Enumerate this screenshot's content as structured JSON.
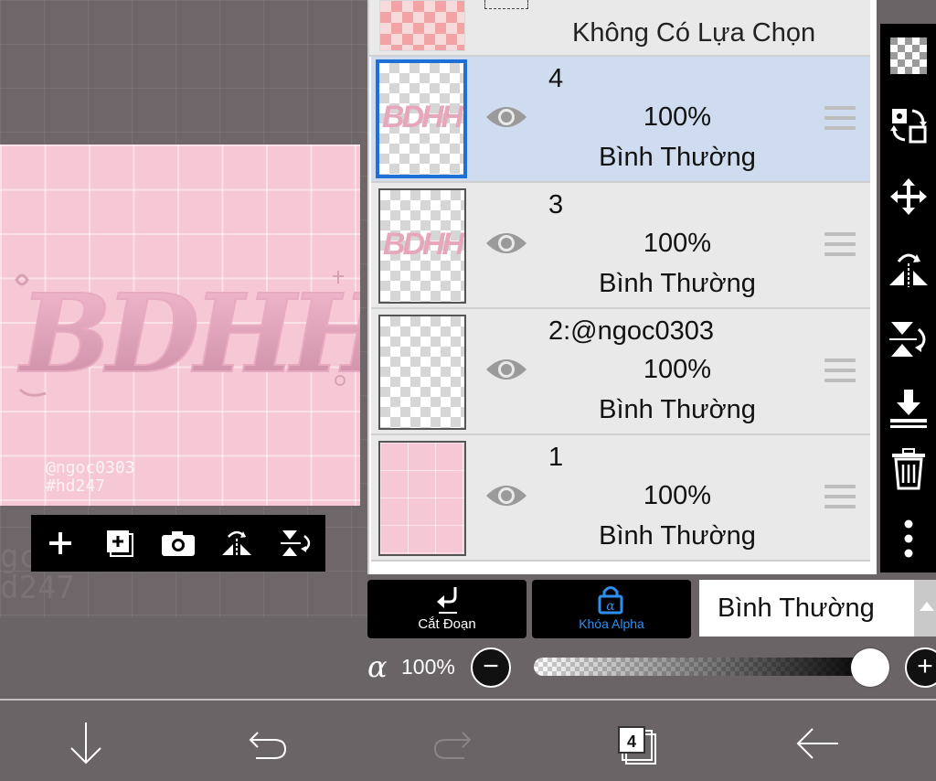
{
  "canvas": {
    "artwork_text": "BDHH",
    "watermark": "@ngoc0303\n#hd247",
    "ghost_watermark": "gc\nd247"
  },
  "layer_toolbar": {
    "icons": [
      "plus-icon",
      "add-layer-icon",
      "camera-icon",
      "flip-horizontal-icon",
      "flip-vertical-icon"
    ]
  },
  "no_selection": {
    "label": "Không Có Lựa Chọn"
  },
  "layers": [
    {
      "name": "4",
      "opacity": "100%",
      "blend": "Bình Thường",
      "selected": true,
      "thumb_text": "BDHH"
    },
    {
      "name": "3",
      "opacity": "100%",
      "blend": "Bình Thường",
      "selected": false,
      "thumb_text": "BDHH"
    },
    {
      "name": "2:@ngoc0303",
      "opacity": "100%",
      "blend": "Bình Thường",
      "selected": false,
      "thumb_text": ""
    },
    {
      "name": "1",
      "opacity": "100%",
      "blend": "Bình Thường",
      "selected": false,
      "thumb_text": ""
    }
  ],
  "right_toolbar": {
    "icons": [
      "checkerboard-icon",
      "transform-icon",
      "move-icon",
      "flip-horizontal-icon",
      "flip-vertical-icon",
      "merge-down-icon",
      "trash-icon",
      "more-icon"
    ]
  },
  "actions": {
    "clip_label": "Cắt Đoạn",
    "alpha_lock_label": "Khóa Alpha",
    "blend_mode": "Bình Thường"
  },
  "alpha": {
    "symbol": "α",
    "value_label": "100%",
    "value": 1.0,
    "minus_label": "−",
    "plus_label": "+"
  },
  "nav": {
    "layer_count": "4",
    "icons": [
      "down-arrow-icon",
      "undo-icon",
      "redo-icon",
      "layers-icon",
      "back-arrow-icon"
    ]
  },
  "colors": {
    "selected_row": "#cfdcef",
    "selected_border": "#1e6fd6",
    "alpha_lock_accent": "#2f8ff0",
    "canvas_pink": "#f6c8d6"
  }
}
